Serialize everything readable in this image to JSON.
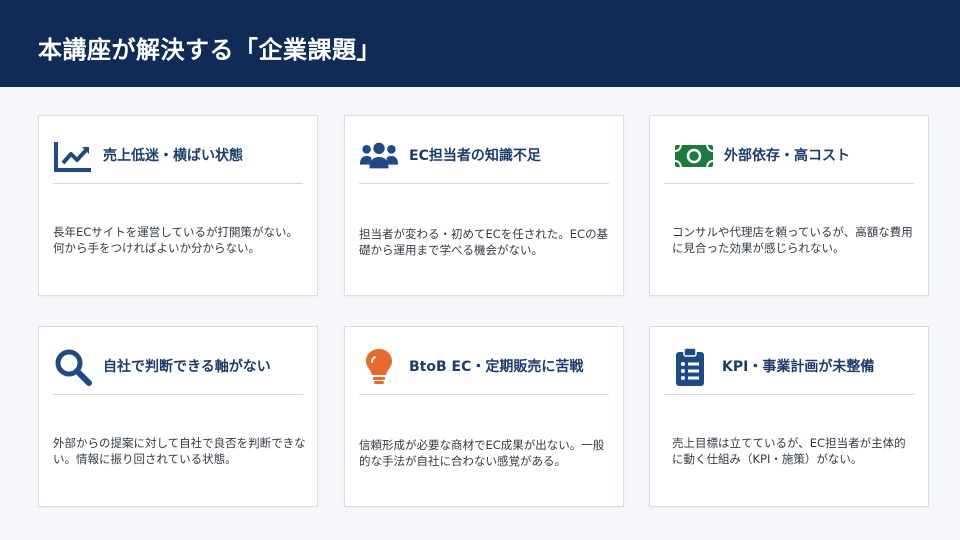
{
  "header": {
    "title": "本講座が解決する「企業課題」"
  },
  "colors": {
    "header_bg": "#0f2b56",
    "title_text": "#1c3d6b",
    "icon_blue": "#1f4a86",
    "icon_green": "#1d7a3e",
    "icon_orange": "#e8692c"
  },
  "cards": [
    {
      "icon": "chart-line-icon",
      "title": "売上低迷・横ばい状態",
      "desc": "長年ECサイトを運営しているが打開策がない。何から手をつければよいか分からない。"
    },
    {
      "icon": "users-icon",
      "title": "EC担当者の知識不足",
      "desc": "担当者が変わる・初めてECを任された。ECの基礎から運用まで学べる機会がない。"
    },
    {
      "icon": "money-bill-icon",
      "title": "外部依存・高コスト",
      "desc": "コンサルや代理店を頼っているが、高額な費用に見合った効果が感じられない。"
    },
    {
      "icon": "search-icon",
      "title": "自社で判断できる軸がない",
      "desc": "外部からの提案に対して自社で良否を判断できない。情報に振り回されている状態。"
    },
    {
      "icon": "lightbulb-icon",
      "title": "BtoB EC・定期販売に苦戦",
      "desc": "信頼形成が必要な商材でEC成果が出ない。一般的な手法が自社に合わない感覚がある。"
    },
    {
      "icon": "clipboard-list-icon",
      "title": "KPI・事業計画が未整備",
      "desc": "売上目標は立てているが、EC担当者が主体的に動く仕組み（KPI・施策）がない。"
    }
  ]
}
